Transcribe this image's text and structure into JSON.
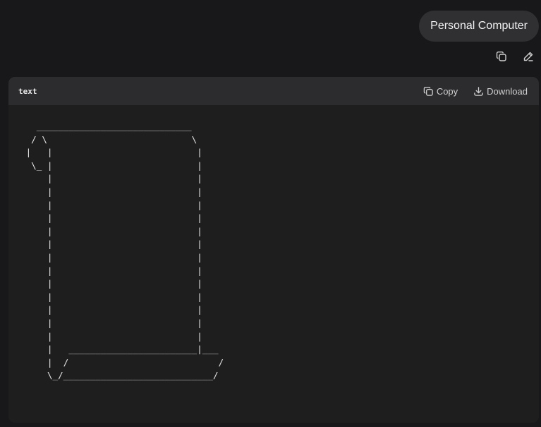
{
  "user_message": {
    "text": "Personal Computer"
  },
  "message_actions": {
    "copy_icon": "copy-icon",
    "edit_icon": "pencil-icon"
  },
  "code_block": {
    "language": "text",
    "copy_label": "Copy",
    "download_label": "Download",
    "content": "   _____________________________\n  / \\                           \\\n |   |                           |\n  \\_ |                           |\n     |                           |\n     |                           |\n     |                           |\n     |                           |\n     |                           |\n     |                           |\n     |                           |\n     |                           |\n     |                           |\n     |                           |\n     |                           |\n     |                           |\n     |                           |\n     |   ________________________|___\n     |  /                            /\n     \\_/____________________________/"
  }
}
